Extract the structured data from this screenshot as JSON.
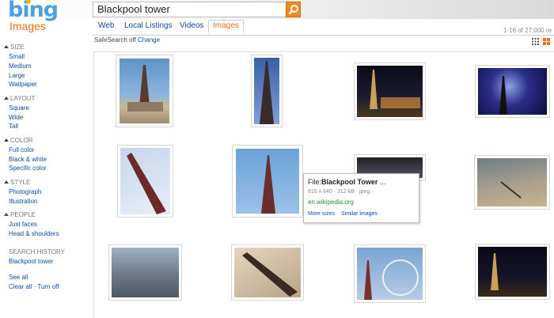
{
  "brand": {
    "logo": "bing",
    "section": "Images"
  },
  "search": {
    "query": "Blackpool tower"
  },
  "tabs": [
    {
      "label": "Web",
      "active": false
    },
    {
      "label": "Local Listings",
      "active": false
    },
    {
      "label": "Videos",
      "active": false
    },
    {
      "label": "Images",
      "active": true
    }
  ],
  "results": {
    "count_text": "1-16 of 27,000 re"
  },
  "safesearch": {
    "label": "SafeSearch off",
    "change": "Change"
  },
  "sidebar": {
    "size": {
      "title": "SIZE",
      "items": [
        "Small",
        "Medium",
        "Large",
        "Wallpaper"
      ]
    },
    "layout": {
      "title": "LAYOUT",
      "items": [
        "Square",
        "Wide",
        "Tall"
      ]
    },
    "color": {
      "title": "COLOR",
      "items": [
        "Full color",
        "Black & white",
        "Specific color"
      ]
    },
    "style": {
      "title": "STYLE",
      "items": [
        "Photograph",
        "Illustration"
      ]
    },
    "people": {
      "title": "PEOPLE",
      "items": [
        "Just faces",
        "Head & shoulders"
      ]
    },
    "history": {
      "title": "SEARCH HISTORY",
      "items": [
        "Blackpool tower"
      ]
    },
    "see_all": "See all",
    "clear_all": "Clear all",
    "separator": "·",
    "turn_off": "Turn off"
  },
  "hover_card": {
    "title_prefix": "File:",
    "title_bold": "Blackpool Tower",
    "title_suffix": " ...",
    "meta": "615 x 640 · 212 kB · jpeg",
    "url": "en.wikipedia.org",
    "more_sizes": "More sizes",
    "similar": "Similar images"
  },
  "colors": {
    "accent": "#e8701a",
    "link": "#0e4ca0",
    "logo": "#4aa3df",
    "url_green": "#2e8b3a"
  }
}
